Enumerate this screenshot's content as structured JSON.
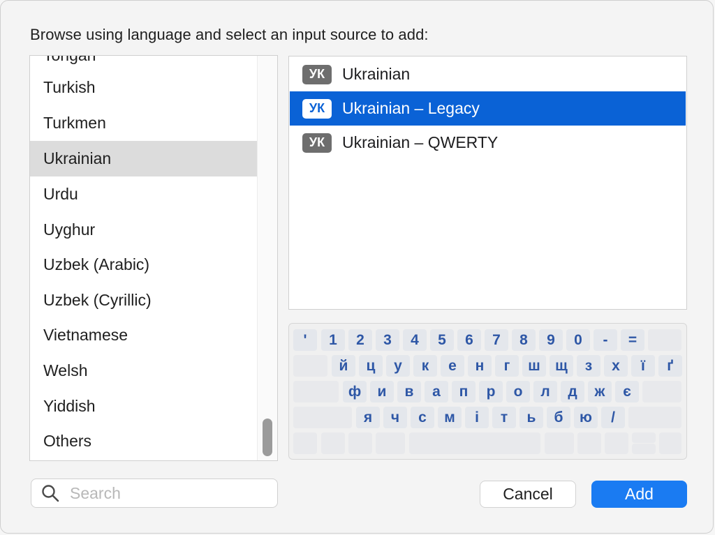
{
  "dialog": {
    "prompt": "Browse using language and select an input source to add:"
  },
  "languages": {
    "items": [
      {
        "label": "Tongan"
      },
      {
        "label": "Turkish"
      },
      {
        "label": "Turkmen"
      },
      {
        "label": "Ukrainian"
      },
      {
        "label": "Urdu"
      },
      {
        "label": "Uyghur"
      },
      {
        "label": "Uzbek (Arabic)"
      },
      {
        "label": "Uzbek (Cyrillic)"
      },
      {
        "label": "Vietnamese"
      },
      {
        "label": "Welsh"
      },
      {
        "label": "Yiddish"
      },
      {
        "label": "Others"
      }
    ],
    "selected": "Ukrainian"
  },
  "sources": {
    "items": [
      {
        "badge": "УК",
        "label": "Ukrainian"
      },
      {
        "badge": "УК",
        "label": "Ukrainian – Legacy"
      },
      {
        "badge": "УК",
        "label": "Ukrainian – QWERTY"
      }
    ],
    "selected": "Ukrainian – Legacy"
  },
  "keyboard": {
    "row1": [
      "'",
      "1",
      "2",
      "3",
      "4",
      "5",
      "6",
      "7",
      "8",
      "9",
      "0",
      "-",
      "=",
      ""
    ],
    "row2": [
      "",
      "й",
      "ц",
      "у",
      "к",
      "е",
      "н",
      "г",
      "ш",
      "щ",
      "з",
      "х",
      "ї",
      "ґ"
    ],
    "row3": [
      "",
      "ф",
      "и",
      "в",
      "а",
      "п",
      "р",
      "о",
      "л",
      "д",
      "ж",
      "є",
      ""
    ],
    "row4": [
      "",
      "я",
      "ч",
      "с",
      "м",
      "і",
      "т",
      "ь",
      "б",
      "ю",
      "/",
      ""
    ]
  },
  "search": {
    "placeholder": "Search",
    "value": ""
  },
  "buttons": {
    "cancel": "Cancel",
    "add": "Add"
  },
  "colors": {
    "accent": "#0a62d6",
    "add_button": "#1a7bf2",
    "key_text": "#2e57a6"
  }
}
